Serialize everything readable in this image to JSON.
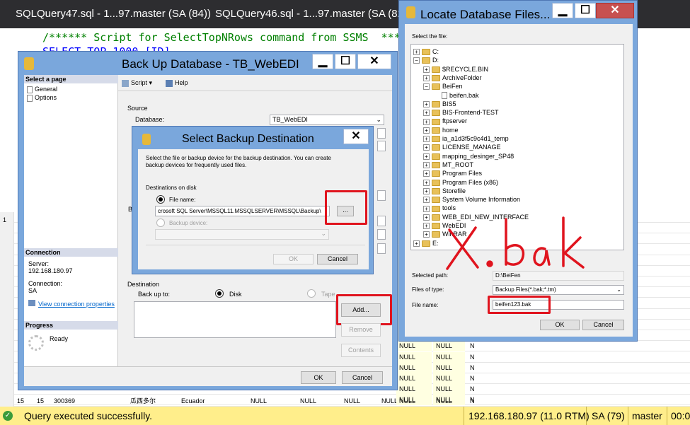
{
  "ssms": {
    "tabs": [
      "SQLQuery47.sql - 1...97.master (SA (84))",
      "SQLQuery46.sql - 1...97.master (SA (82))"
    ],
    "code_line1": "/****** Script for SelectTopNRows command from SSMS  ******/",
    "code_line2": "SELECT TOP 1000 [ID]",
    "row_gutter": "1",
    "bottom_row": {
      "num": "15",
      "id": "15",
      "code": "300369",
      "name": "瓜西多尔",
      "country": "Ecuador"
    },
    "null": "NULL",
    "n": "N"
  },
  "status": {
    "message": "Query executed successfully.",
    "server": "192.168.180.97 (11.0 RTM)",
    "user": "SA (79)",
    "db": "master",
    "time": "00:0"
  },
  "backup": {
    "title": "Back Up Database - TB_WebEDI",
    "select_page": "Select a page",
    "pages": [
      "General",
      "Options"
    ],
    "script": "Script",
    "help": "Help",
    "source": "Source",
    "database_label": "Database:",
    "database_value": "TB_WebEDI",
    "connection_header": "Connection",
    "server_label": "Server:",
    "server_value": "192.168.180.97",
    "connection_label": "Connection:",
    "connection_value": "SA",
    "view_conn": "View connection properties",
    "progress_header": "Progress",
    "progress_status": "Ready",
    "destination": "Destination",
    "backup_to": "Back up to:",
    "disk": "Disk",
    "tape": "Tape",
    "add": "Add...",
    "remove": "Remove",
    "contents": "Contents",
    "ok": "OK",
    "cancel": "Cancel",
    "ba_label": "Ba"
  },
  "select_dest": {
    "title": "Select Backup Destination",
    "desc": "Select the file or backup device for the backup destination. You can create backup devices for frequently used files.",
    "on_disk": "Destinations on disk",
    "file_name": "File name:",
    "file_value": "crosoft SQL Server\\MSSQL11.MSSQLSERVER\\MSSQL\\Backup\\",
    "browse": "...",
    "backup_device": "Backup device:",
    "ok": "OK",
    "cancel": "Cancel"
  },
  "locate": {
    "title": "Locate Database Files...",
    "select_file": "Select the file:",
    "tree": [
      {
        "label": "C:",
        "level": 0,
        "kind": "folder",
        "expander": "+"
      },
      {
        "label": "D:",
        "level": 0,
        "kind": "folder",
        "expander": "-"
      },
      {
        "label": "$RECYCLE.BIN",
        "level": 1,
        "kind": "folder",
        "expander": "+"
      },
      {
        "label": "ArchiveFolder",
        "level": 1,
        "kind": "folder",
        "expander": "+"
      },
      {
        "label": "BeiFen",
        "level": 1,
        "kind": "folder",
        "expander": "-"
      },
      {
        "label": "beifen.bak",
        "level": 2,
        "kind": "file",
        "expander": ""
      },
      {
        "label": "BIS5",
        "level": 1,
        "kind": "folder",
        "expander": "+"
      },
      {
        "label": "BIS-Frontend-TEST",
        "level": 1,
        "kind": "folder",
        "expander": "+"
      },
      {
        "label": "ftpserver",
        "level": 1,
        "kind": "folder",
        "expander": "+"
      },
      {
        "label": "home",
        "level": 1,
        "kind": "folder",
        "expander": "+"
      },
      {
        "label": "ia_a1d3f5c9c4d1_temp",
        "level": 1,
        "kind": "folder",
        "expander": "+"
      },
      {
        "label": "LICENSE_MANAGE",
        "level": 1,
        "kind": "folder",
        "expander": "+"
      },
      {
        "label": "mapping_desinger_SP48",
        "level": 1,
        "kind": "folder",
        "expander": "+"
      },
      {
        "label": "MT_ROOT",
        "level": 1,
        "kind": "folder",
        "expander": "+"
      },
      {
        "label": "Program Files",
        "level": 1,
        "kind": "folder",
        "expander": "+"
      },
      {
        "label": "Program Files (x86)",
        "level": 1,
        "kind": "folder",
        "expander": "+"
      },
      {
        "label": "Storefile",
        "level": 1,
        "kind": "folder",
        "expander": "+"
      },
      {
        "label": "System Volume Information",
        "level": 1,
        "kind": "folder",
        "expander": "+"
      },
      {
        "label": "tools",
        "level": 1,
        "kind": "folder",
        "expander": "+"
      },
      {
        "label": "WEB_EDI_NEW_INTERFACE",
        "level": 1,
        "kind": "folder",
        "expander": "+"
      },
      {
        "label": "WebEDI",
        "level": 1,
        "kind": "folder",
        "expander": "+"
      },
      {
        "label": "WinRAR",
        "level": 1,
        "kind": "folder",
        "expander": "+"
      },
      {
        "label": "E:",
        "level": 0,
        "kind": "folder",
        "expander": "+"
      }
    ],
    "selected_path_label": "Selected path:",
    "selected_path": "D:\\BeiFen",
    "files_type_label": "Files of type:",
    "files_type": "Backup Files(*.bak;*.tm)",
    "file_name_label": "File name:",
    "file_name": "beifen123.bak",
    "ok": "OK",
    "cancel": "Cancel"
  },
  "annotation": {
    "text": "x.bak",
    "color": "#e0141e"
  },
  "colors": {
    "accent": "#e0141e",
    "titlebar": "#7aa7dc",
    "status": "#ffee8b",
    "link": "#0066cc"
  }
}
